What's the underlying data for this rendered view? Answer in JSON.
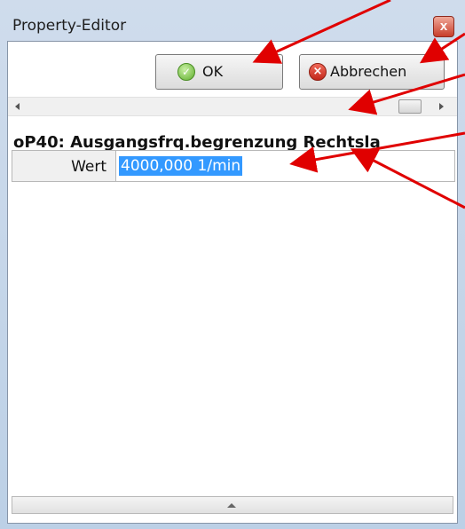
{
  "window": {
    "title": "Property-Editor",
    "close_glyph": "x"
  },
  "toolbar": {
    "ok_label": "OK",
    "ok_icon": "check-circle-icon",
    "cancel_label": "Abbrechen",
    "cancel_icon": "red-x-icon"
  },
  "scrollbar": {
    "left_icon": "arrow-left-icon",
    "right_icon": "arrow-right-icon"
  },
  "property": {
    "heading": "oP40:  Ausgangsfrq.begrenzung Rechtsla",
    "label": "Wert",
    "value": "4000,000 1/min"
  },
  "colors": {
    "annotation_arrow": "#e00000",
    "selection": "#3399ff"
  }
}
